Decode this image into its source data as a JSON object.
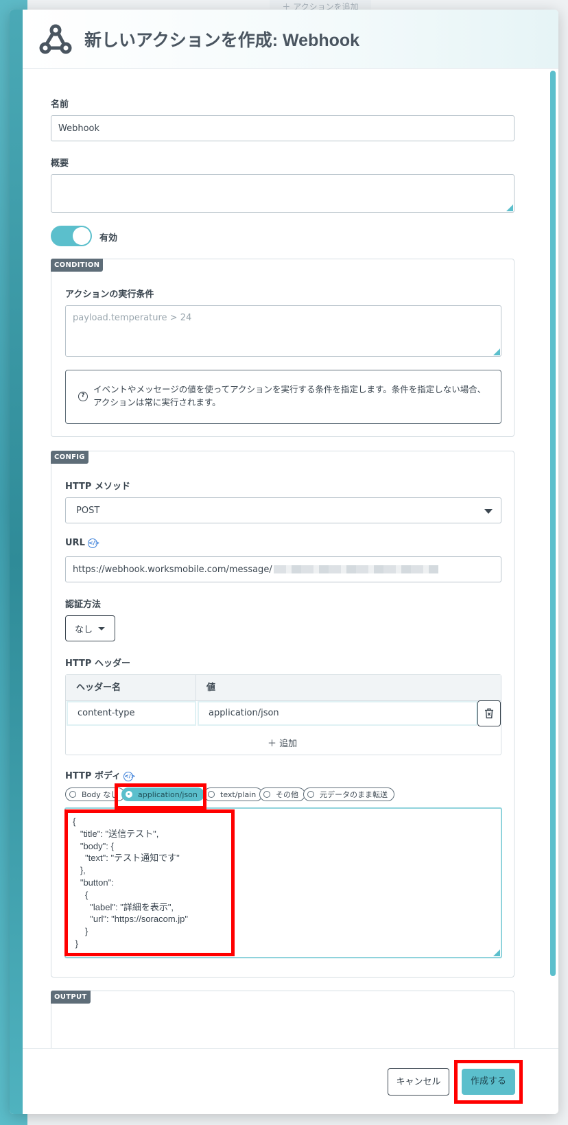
{
  "background": {
    "top_button_label": "＋ アクションを追加"
  },
  "header": {
    "title": "新しいアクションを作成: Webhook"
  },
  "form": {
    "name_label": "名前",
    "name_value": "Webhook",
    "summary_label": "概要",
    "summary_value": "",
    "enabled_label": "有効",
    "enabled": true
  },
  "condition": {
    "tag": "CONDITION",
    "label": "アクションの実行条件",
    "placeholder": "payload.temperature > 24",
    "help_text": "イベントやメッセージの値を使ってアクションを実行する条件を指定します。条件を指定しない場合、アクションは常に実行されます。"
  },
  "config": {
    "tag": "CONFIG",
    "method_label": "HTTP メソッド",
    "method_value": "POST",
    "url_label": "URL",
    "url_value": "https://webhook.worksmobile.com/message/",
    "auth_label": "認証方法",
    "auth_value": "なし",
    "headers_label": "HTTP ヘッダー",
    "headers_col_name": "ヘッダー名",
    "headers_col_value": "値",
    "headers": [
      {
        "name": "content-type",
        "value": "application/json"
      }
    ],
    "add_label": "＋ 追加",
    "body_label": "HTTP ボディ",
    "body_options": [
      "Body なし",
      "application/json",
      "text/plain",
      "その他",
      "元データのまま転送"
    ],
    "body_selected": "application/json",
    "body_value": "{\n   \"title\": \"送信テスト\",\n   \"body\": {\n     \"text\": \"テスト通知です\"\n   },\n   \"button\":\n     {\n       \"label\": \"詳細を表示\",\n       \"url\": \"https://soracom.jp\"\n     }\n }"
  },
  "output": {
    "tag": "OUTPUT"
  },
  "footer": {
    "cancel_label": "キャンセル",
    "create_label": "作成する"
  },
  "colors": {
    "accent": "#5bbfcc",
    "highlight": "#ff0000",
    "tag_bg": "#5e6d78"
  }
}
